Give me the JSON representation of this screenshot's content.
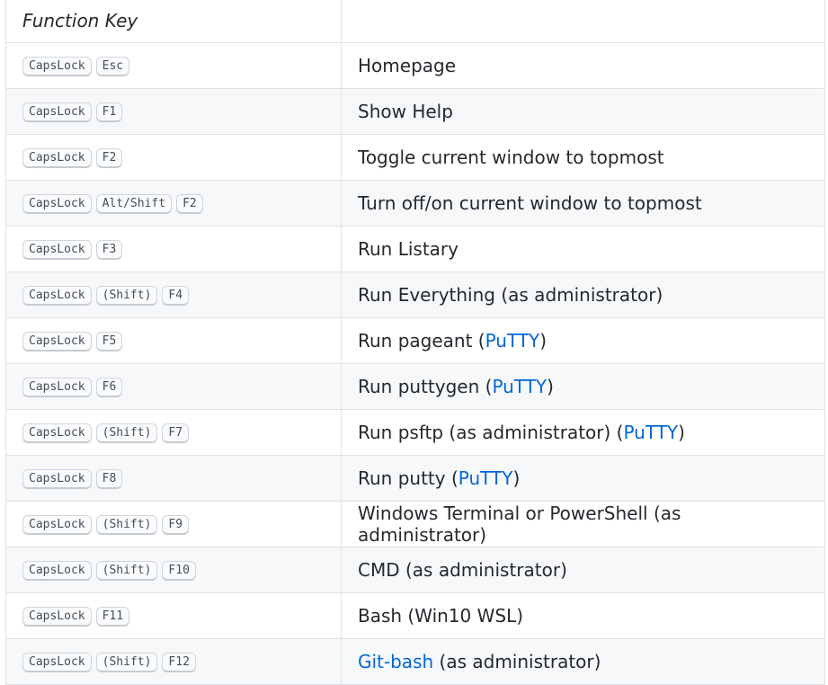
{
  "header": {
    "key_column": "Function Key",
    "description_column": ""
  },
  "rows": [
    {
      "keys": [
        "CapsLock",
        "Esc"
      ],
      "desc": [
        {
          "t": "Homepage"
        }
      ]
    },
    {
      "keys": [
        "CapsLock",
        "F1"
      ],
      "desc": [
        {
          "t": "Show Help"
        }
      ]
    },
    {
      "keys": [
        "CapsLock",
        "F2"
      ],
      "desc": [
        {
          "t": "Toggle current window to topmost"
        }
      ]
    },
    {
      "keys": [
        "CapsLock",
        "Alt/Shift",
        "F2"
      ],
      "desc": [
        {
          "t": "Turn off/on current window to topmost"
        }
      ]
    },
    {
      "keys": [
        "CapsLock",
        "F3"
      ],
      "desc": [
        {
          "t": "Run Listary"
        }
      ]
    },
    {
      "keys": [
        "CapsLock",
        "(Shift)",
        "F4"
      ],
      "desc": [
        {
          "t": "Run Everything (as administrator)"
        }
      ]
    },
    {
      "keys": [
        "CapsLock",
        "F5"
      ],
      "desc": [
        {
          "t": "Run pageant ("
        },
        {
          "t": "PuTTY",
          "link": true
        },
        {
          "t": ")"
        }
      ]
    },
    {
      "keys": [
        "CapsLock",
        "F6"
      ],
      "desc": [
        {
          "t": "Run puttygen ("
        },
        {
          "t": "PuTTY",
          "link": true
        },
        {
          "t": ")"
        }
      ]
    },
    {
      "keys": [
        "CapsLock",
        "(Shift)",
        "F7"
      ],
      "desc": [
        {
          "t": "Run psftp (as administrator) ("
        },
        {
          "t": "PuTTY",
          "link": true
        },
        {
          "t": ")"
        }
      ]
    },
    {
      "keys": [
        "CapsLock",
        "F8"
      ],
      "desc": [
        {
          "t": "Run putty ("
        },
        {
          "t": "PuTTY",
          "link": true
        },
        {
          "t": ")"
        }
      ]
    },
    {
      "keys": [
        "CapsLock",
        "(Shift)",
        "F9"
      ],
      "desc": [
        {
          "t": "Windows Terminal or PowerShell (as administrator)"
        }
      ]
    },
    {
      "keys": [
        "CapsLock",
        "(Shift)",
        "F10"
      ],
      "desc": [
        {
          "t": "CMD (as administrator)"
        }
      ]
    },
    {
      "keys": [
        "CapsLock",
        "F11"
      ],
      "desc": [
        {
          "t": "Bash (Win10 WSL)"
        }
      ]
    },
    {
      "keys": [
        "CapsLock",
        "(Shift)",
        "F12"
      ],
      "desc": [
        {
          "t": "Git-bash",
          "link": true
        },
        {
          "t": " (as administrator)"
        }
      ]
    }
  ],
  "colors": {
    "link": "#0366d6",
    "text": "#24292e",
    "border": "#dfe2e5",
    "row_alt": "#f6f8fa"
  }
}
